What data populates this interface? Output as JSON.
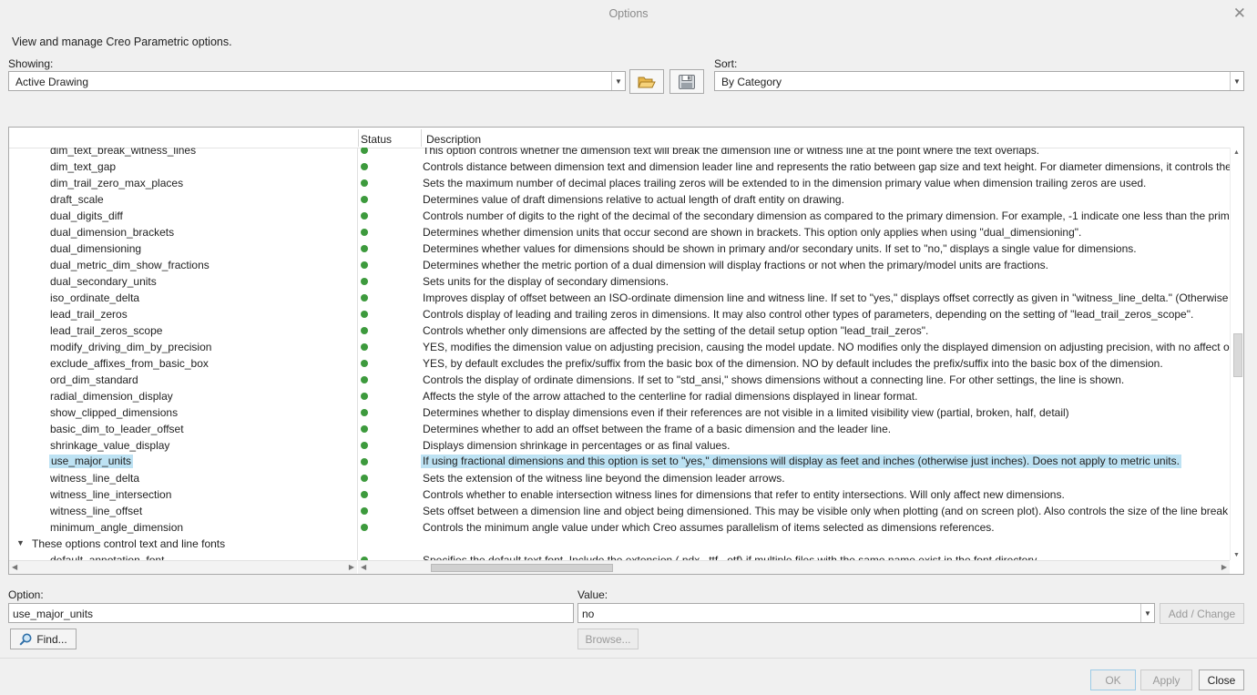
{
  "window": {
    "title": "Options",
    "close_glyph": "✕"
  },
  "intro": "View and manage Creo Parametric options.",
  "showing": {
    "label": "Showing:",
    "value": "Active Drawing"
  },
  "toolbar": {
    "open_icon": "folder-open-icon",
    "save_icon": "save-icon"
  },
  "sort": {
    "label": "Sort:",
    "value": "By Category"
  },
  "table": {
    "headers": {
      "status": "Status",
      "description": "Description"
    },
    "rows": [
      {
        "name": "dim_text_break_witness_lines",
        "desc": "This option controls whether the dimension text will break the dimension line or witness line at the point where the text overlaps."
      },
      {
        "name": "dim_text_gap",
        "desc": "Controls distance between dimension text and dimension leader line and represents the ratio between gap size and text height. For diameter dimensions, it controls the d"
      },
      {
        "name": "dim_trail_zero_max_places",
        "desc": "Sets the maximum number of decimal places trailing zeros will be extended to in the dimension primary value when dimension trailing zeros are used."
      },
      {
        "name": "draft_scale",
        "desc": "Determines value of draft dimensions relative to actual length of draft entity on drawing."
      },
      {
        "name": "dual_digits_diff",
        "desc": "Controls number of digits to the right of the decimal of the secondary dimension as compared to the primary dimension. For example, -1 indicate one less than the prim"
      },
      {
        "name": "dual_dimension_brackets",
        "desc": "Determines whether dimension units that occur second are shown in brackets. This option only applies when using \"dual_dimensioning\"."
      },
      {
        "name": "dual_dimensioning",
        "desc": "Determines whether values for dimensions should be shown in primary and/or secondary units. If set to \"no,\" displays a single value for dimensions."
      },
      {
        "name": "dual_metric_dim_show_fractions",
        "desc": "Determines whether the metric portion of a dual dimension will display fractions or not when the primary/model units are fractions."
      },
      {
        "name": "dual_secondary_units",
        "desc": "Sets units for the display of secondary dimensions."
      },
      {
        "name": "iso_ordinate_delta",
        "desc": "Improves display of offset between an ISO-ordinate dimension line and witness line. If set to \"yes,\" displays offset correctly as given in \"witness_line_delta.\" (Otherwise \"o"
      },
      {
        "name": "lead_trail_zeros",
        "desc": "Controls display of leading and trailing zeros in dimensions. It may also control other types of parameters, depending on the setting of \"lead_trail_zeros_scope\"."
      },
      {
        "name": "lead_trail_zeros_scope",
        "desc": "Controls whether only dimensions are affected by the setting of the detail setup option \"lead_trail_zeros\"."
      },
      {
        "name": "modify_driving_dim_by_precision",
        "desc": "YES, modifies the dimension value on adjusting precision, causing the model update. NO modifies only the displayed dimension on adjusting precision, with no affect o"
      },
      {
        "name": "exclude_affixes_from_basic_box",
        "desc": "YES, by default excludes the prefix/suffix from the basic box of the dimension. NO by default includes the prefix/suffix into the basic box of the dimension."
      },
      {
        "name": "ord_dim_standard",
        "desc": "Controls the display of ordinate dimensions. If set to \"std_ansi,\" shows dimensions without a connecting line. For other settings, the line is shown."
      },
      {
        "name": "radial_dimension_display",
        "desc": "Affects the style of the arrow attached to the centerline for radial dimensions displayed in linear format."
      },
      {
        "name": "show_clipped_dimensions",
        "desc": "Determines whether to display dimensions even if their references are not visible in a limited visibility view (partial, broken, half, detail)"
      },
      {
        "name": "basic_dim_to_leader_offset",
        "desc": "Determines whether to add an offset between the frame of a basic dimension and the leader line."
      },
      {
        "name": "shrinkage_value_display",
        "desc": "Displays dimension shrinkage in percentages or as final values."
      },
      {
        "name": "use_major_units",
        "desc": "If using fractional dimensions and this option is set to \"yes,\" dimensions will display as feet and inches (otherwise just inches). Does not apply to metric units."
      },
      {
        "name": "witness_line_delta",
        "desc": "Sets the extension of the witness line beyond the dimension leader arrows."
      },
      {
        "name": "witness_line_intersection",
        "desc": "Controls whether to enable intersection witness lines for dimensions that refer to entity intersections. Will only affect new dimensions."
      },
      {
        "name": "witness_line_offset",
        "desc": "Sets offset between a dimension line and object being dimensioned. This may be visible only when plotting (and on screen plot). Also controls the size of the line break a"
      },
      {
        "name": "minimum_angle_dimension",
        "desc": "Controls the minimum angle value under which Creo assumes parallelism of items selected as dimensions references."
      }
    ],
    "selected_row": "use_major_units",
    "category": "These options control text and line fonts",
    "partial_row": {
      "name": "default_annotation_font",
      "desc": "Specifies the default text font. Include the extension (.ndx, .ttf, .otf) if multiple files with the same name exist in the font directory."
    },
    "status_color": "#3d9a3d",
    "selection_color": "#bde2f3"
  },
  "option_field": {
    "label": "Option:",
    "value": "use_major_units"
  },
  "value_field": {
    "label": "Value:",
    "value": "no"
  },
  "buttons": {
    "add_change": "Add / Change",
    "find": "Find...",
    "browse": "Browse...",
    "ok": "OK",
    "apply": "Apply",
    "close": "Close"
  }
}
